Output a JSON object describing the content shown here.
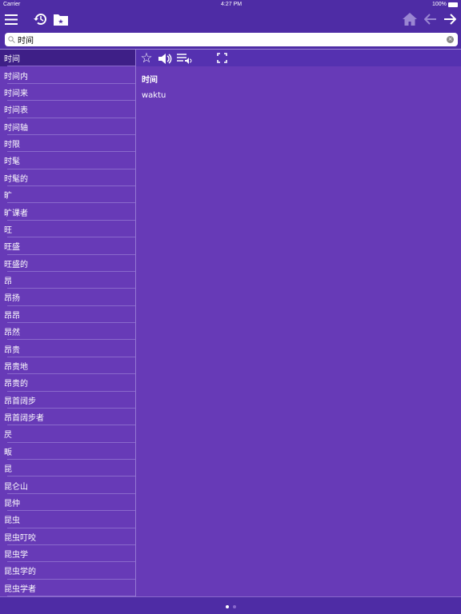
{
  "status": {
    "carrier": "Carrier",
    "time": "4:27 PM",
    "battery": "100%"
  },
  "toolbar": {
    "icons": [
      "menu-icon",
      "history-icon",
      "bookmark-folder-icon",
      "home-icon",
      "back-arrow-icon",
      "forward-arrow-icon"
    ]
  },
  "search": {
    "value": "时间"
  },
  "list": [
    "时间",
    "时间内",
    "时间来",
    "时间表",
    "时间轴",
    "时限",
    "时髦",
    "时髦的",
    "旷",
    "旷课者",
    "旺",
    "旺盛",
    "旺盛的",
    "昂",
    "昂扬",
    "昂昂",
    "昂然",
    "昂贵",
    "昂贵地",
    "昂贵的",
    "昂首阔步",
    "昂首阔步者",
    "昃",
    "畈",
    "昆",
    "昆仑山",
    "昆仲",
    "昆虫",
    "昆虫叮咬",
    "昆虫学",
    "昆虫学的",
    "昆虫学者"
  ],
  "entry": {
    "word": "时间",
    "translation": "waktu"
  },
  "colors": {
    "toolbar": "#4e2ca5",
    "list": "#673ab7",
    "selected": "#3e1f87"
  }
}
